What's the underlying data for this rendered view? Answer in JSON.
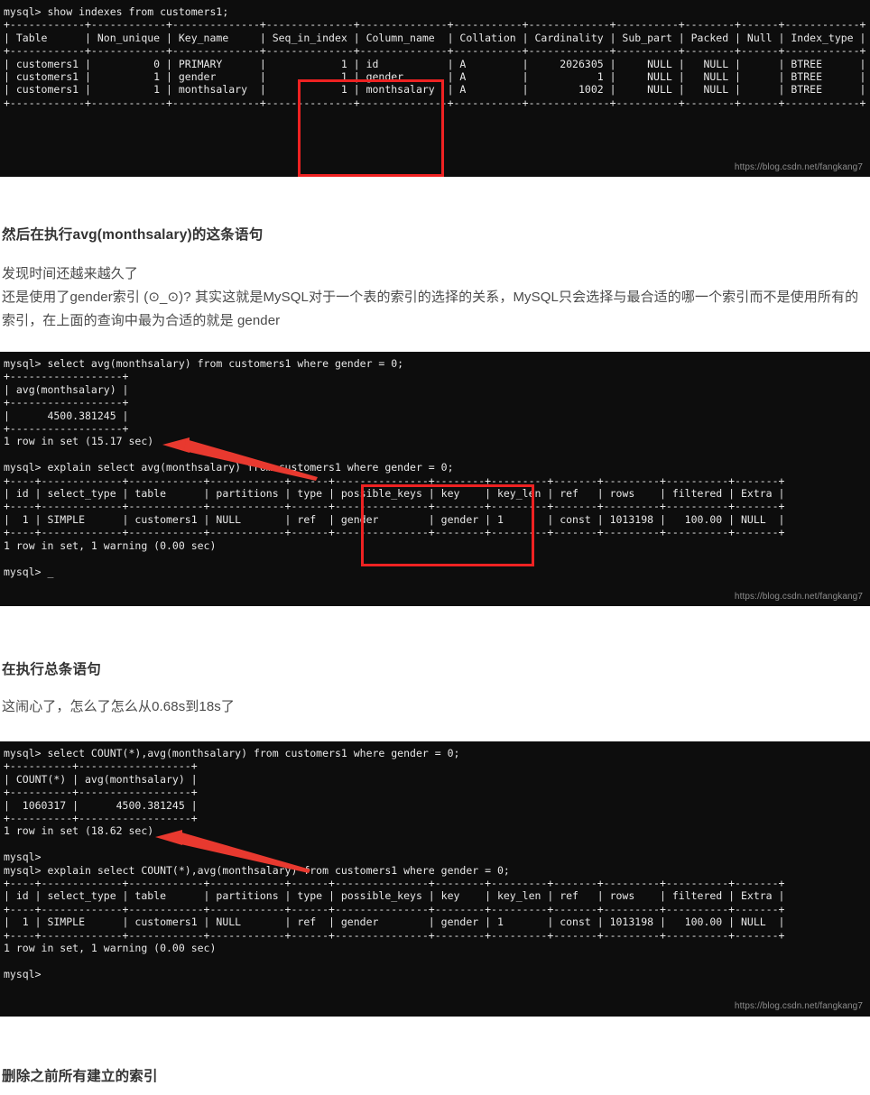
{
  "page": {
    "watermark": "https://blog.csdn.net/fangkang7"
  },
  "terminal1": {
    "name": "show-indexes-terminal",
    "lines": [
      "mysql> show indexes from customers1;",
      "+------------+------------+--------------+--------------+--------------+-----------+-------------+----------+--------+------+------------+",
      "| Table      | Non_unique | Key_name     | Seq_in_index | Column_name  | Collation | Cardinality | Sub_part | Packed | Null | Index_type |",
      "+------------+------------+--------------+--------------+--------------+-----------+-------------+----------+--------+------+------------+",
      "| customers1 |          0 | PRIMARY      |            1 | id           | A         |     2026305 |     NULL |   NULL |      | BTREE      |",
      "| customers1 |          1 | gender       |            1 | gender       | A         |           1 |     NULL |   NULL |      | BTREE      |",
      "| customers1 |          1 | monthsalary  |            1 | monthsalary  | A         |        1002 |     NULL |   NULL |      | BTREE      |",
      "+------------+------------+--------------+--------------+--------------+-----------+-------------+----------+--------+------+------------+"
    ]
  },
  "section1": {
    "heading": "然后在执行avg(monthsalary)的这条语句",
    "para1": "发现时间还越来越久了",
    "para2": "还是使用了gender索引 (⊙_⊙)? 其实这就是MySQL对于一个表的索引的选择的关系，MySQL只会选择与最合适的哪一个索引而不是使用所有的索引，在上面的查询中最为合适的就是 gender"
  },
  "terminal2": {
    "name": "avg-monthsalary-terminal",
    "lines": [
      "mysql> select avg(monthsalary) from customers1 where gender = 0;",
      "+------------------+",
      "| avg(monthsalary) |",
      "+------------------+",
      "|      4500.381245 |",
      "+------------------+",
      "1 row in set (15.17 sec)",
      "",
      "mysql> explain select avg(monthsalary) from customers1 where gender = 0;",
      "+----+-------------+------------+------------+------+---------------+--------+---------+-------+---------+----------+-------+",
      "| id | select_type | table      | partitions | type | possible_keys | key    | key_len | ref   | rows    | filtered | Extra |",
      "+----+-------------+------------+------------+------+---------------+--------+---------+-------+---------+----------+-------+",
      "|  1 | SIMPLE      | customers1 | NULL       | ref  | gender        | gender | 1       | const | 1013198 |   100.00 | NULL  |",
      "+----+-------------+------------+------------+------+---------------+--------+---------+-------+---------+----------+-------+",
      "1 row in set, 1 warning (0.00 sec)",
      "",
      "mysql> _"
    ]
  },
  "section2": {
    "heading": "在执行总条语句",
    "para1": "这闹心了，怎么了怎么从0.68s到18s了"
  },
  "terminal3": {
    "name": "count-avg-terminal",
    "lines": [
      "mysql> select COUNT(*),avg(monthsalary) from customers1 where gender = 0;",
      "+----------+------------------+",
      "| COUNT(*) | avg(monthsalary) |",
      "+----------+------------------+",
      "|  1060317 |      4500.381245 |",
      "+----------+------------------+",
      "1 row in set (18.62 sec)",
      "",
      "mysql>",
      "mysql> explain select COUNT(*),avg(monthsalary) from customers1 where gender = 0;",
      "+----+-------------+------------+------------+------+---------------+--------+---------+-------+---------+----------+-------+",
      "| id | select_type | table      | partitions | type | possible_keys | key    | key_len | ref   | rows    | filtered | Extra |",
      "+----+-------------+------------+------------+------+---------------+--------+---------+-------+---------+----------+-------+",
      "|  1 | SIMPLE      | customers1 | NULL       | ref  | gender        | gender | 1       | const | 1013198 |   100.00 | NULL  |",
      "+----+-------------+------------+------------+------+---------------+--------+---------+-------+---------+----------+-------+",
      "1 row in set, 1 warning (0.00 sec)",
      "",
      "mysql>"
    ]
  },
  "section3": {
    "heading": "删除之前所有建立的索引"
  }
}
